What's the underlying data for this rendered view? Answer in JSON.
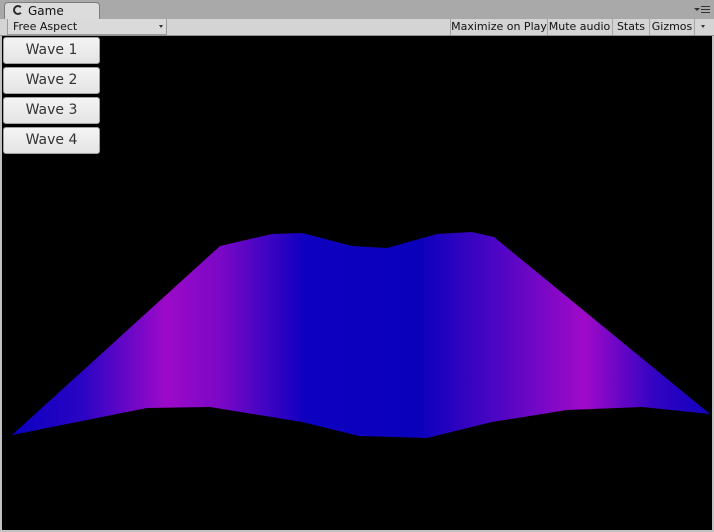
{
  "window": {
    "tab_label": "Game",
    "tab_icon": "unity-icon",
    "menu_icon": "panel-menu-icon"
  },
  "toolbar": {
    "aspect": "Free Aspect",
    "maximize": "Maximize on Play",
    "mute": "Mute audio",
    "stats": "Stats",
    "gizmos": "Gizmos"
  },
  "buttons": [
    "Wave 1",
    "Wave 2",
    "Wave 3",
    "Wave 4"
  ],
  "colors": {
    "viewport_bg": "#000000",
    "wave_blue": "#0a00c0",
    "wave_magenta": "#a00ac8"
  }
}
